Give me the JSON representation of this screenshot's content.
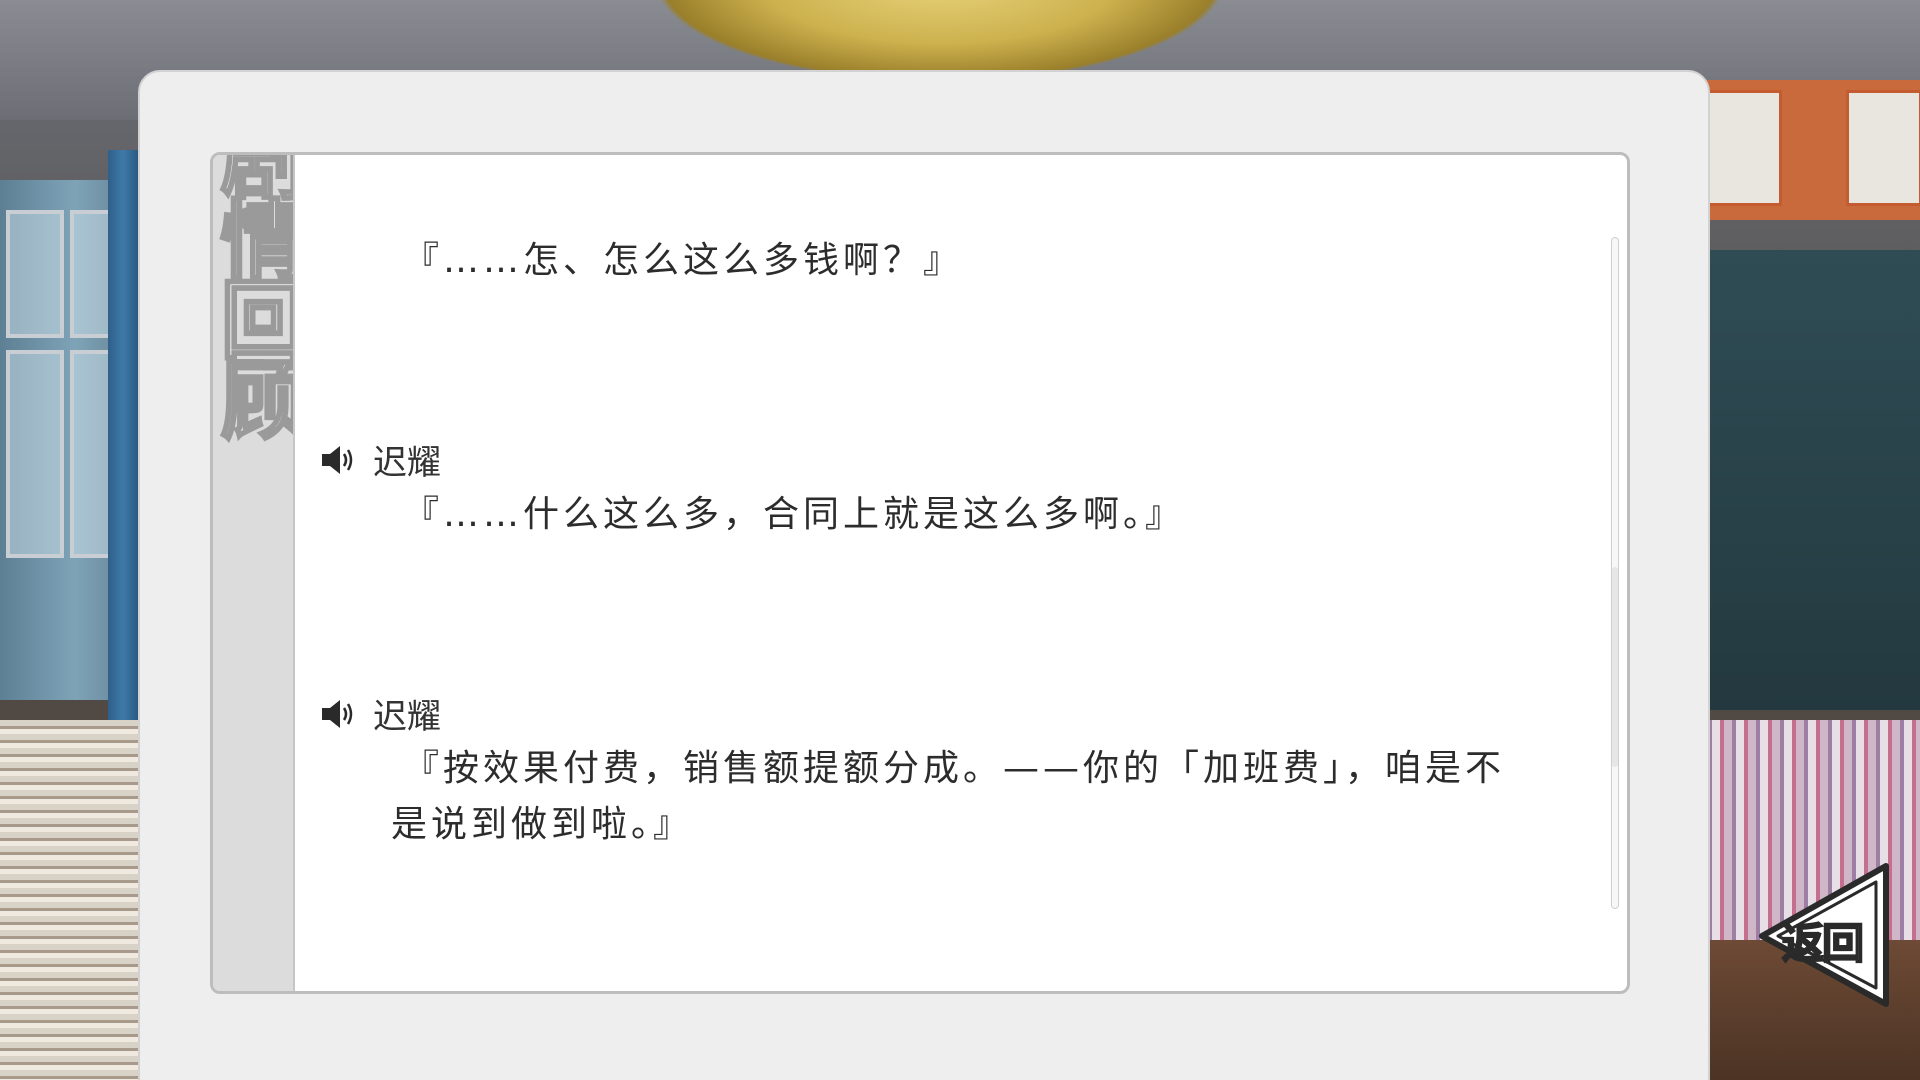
{
  "log_panel": {
    "side_title": "剧情回顾",
    "entries": [
      {
        "speaker": "",
        "has_voice": false,
        "text": "『……怎、怎么这么多钱啊？』"
      },
      {
        "speaker": "迟耀",
        "has_voice": true,
        "text": "『……什么这么多，合同上就是这么多啊。』"
      },
      {
        "speaker": "迟耀",
        "has_voice": true,
        "text_line1": "『按效果付费，销售额提额分成。——你的「加班费」，咱是不",
        "text_line2": "是说到做到啦。』"
      }
    ],
    "scroll_position": 0.7
  },
  "back_button": {
    "label": "返回",
    "icon": "triangle-left-icon"
  },
  "colors": {
    "panel_bg": "#eeeeee",
    "log_bg": "#ffffff",
    "text": "#2c2c2c"
  }
}
